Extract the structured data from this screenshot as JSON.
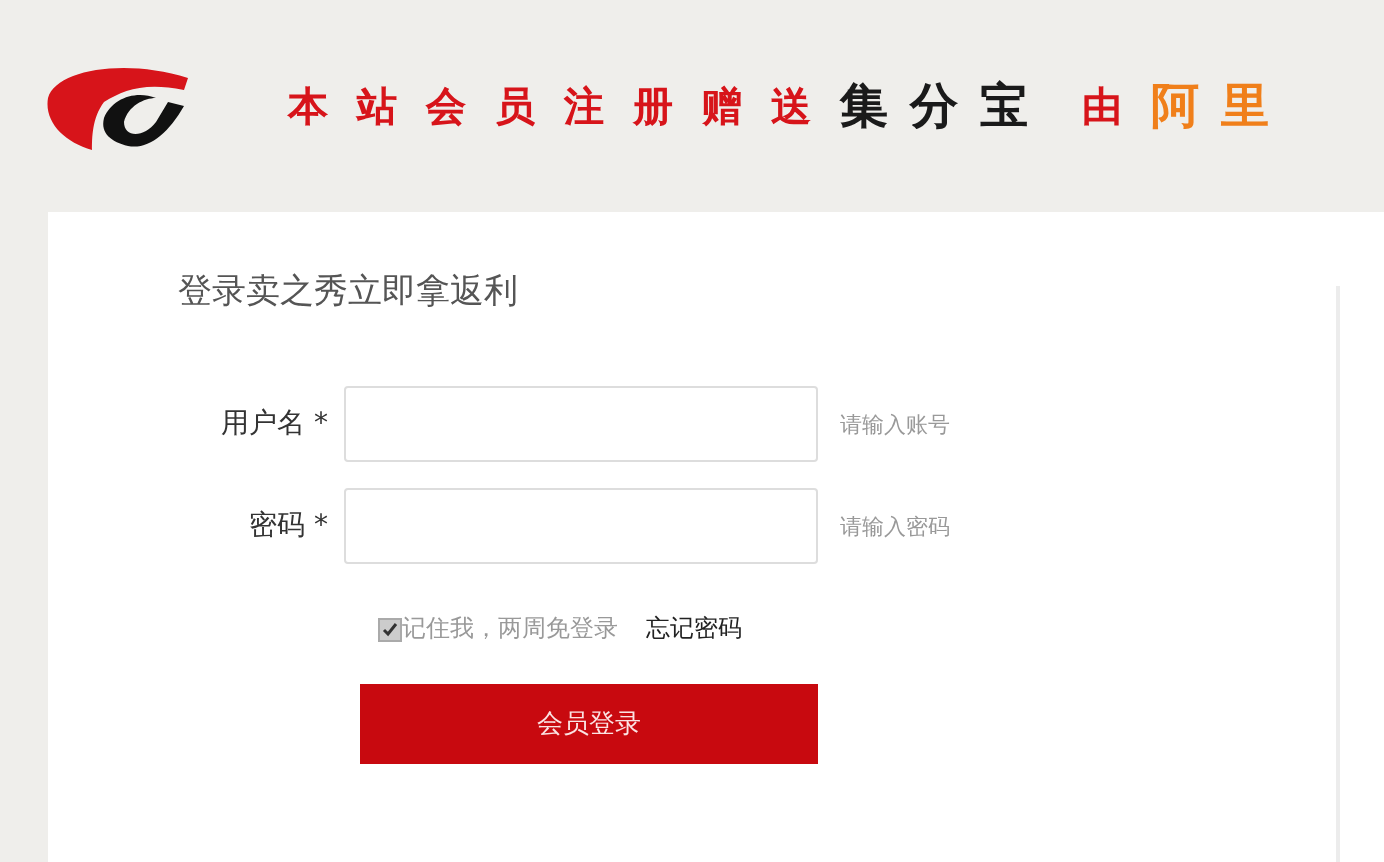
{
  "banner": {
    "segments": [
      {
        "text": "本站会员注册赠送",
        "color": "#d7141a",
        "kind": "small"
      },
      {
        "text": "集分宝",
        "color": "#1a1a1a",
        "kind": "large"
      },
      {
        "text": "由",
        "color": "#d7141a",
        "kind": "small"
      },
      {
        "text": "阿里",
        "color": "#f07f1a",
        "kind": "large"
      }
    ]
  },
  "login": {
    "title": "登录卖之秀立即拿返利",
    "fields": [
      {
        "label": "用户名",
        "required_mark": "*",
        "hint": "请输入账号"
      },
      {
        "label": "密码",
        "required_mark": "*",
        "hint": "请输入密码"
      }
    ],
    "remember": {
      "label": "记住我，两周免登录",
      "checked": true
    },
    "forgot_link": "忘记密码",
    "submit": "会员登录"
  }
}
